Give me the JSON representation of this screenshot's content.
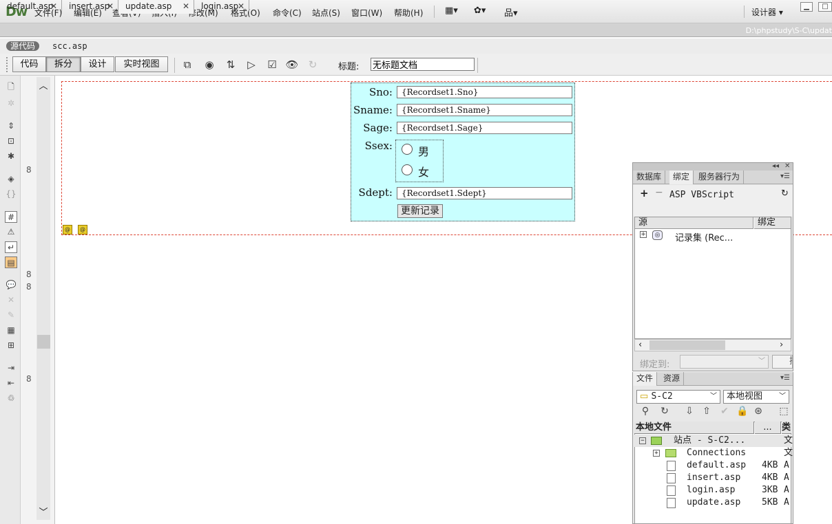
{
  "app": {
    "logo": "Dw"
  },
  "menu": [
    "文件(F)",
    "编辑(E)",
    "查看(V)",
    "插入(I)",
    "修改(M)",
    "格式(O)",
    "命令(C)",
    "站点(S)",
    "窗口(W)",
    "帮助(H)"
  ],
  "workspace": {
    "label": "设计器"
  },
  "tabs": [
    {
      "label": "default.asp"
    },
    {
      "label": "insert.asp"
    },
    {
      "label": "update.asp",
      "active": true
    },
    {
      "label": "login.asp"
    }
  ],
  "doc_path": "D:\\phpstudy\\S-C\\updat",
  "related": {
    "source_badge": "源代码",
    "file": "scc.asp"
  },
  "view_buttons": [
    "代码",
    "拆分",
    "设计",
    "实时视图"
  ],
  "active_view": "拆分",
  "doc_title": {
    "label": "标题:",
    "value": "无标题文档"
  },
  "line_numbers": [
    "8",
    "8",
    "8",
    "8"
  ],
  "form": {
    "fields": [
      {
        "label": "Sno:",
        "value": "{Recordset1.Sno}"
      },
      {
        "label": "Sname:",
        "value": "{Recordset1.Sname}"
      },
      {
        "label": "Sage:",
        "value": "{Recordset1.Sage}"
      }
    ],
    "ssex": {
      "label": "Ssex:",
      "options": [
        "男",
        "女"
      ]
    },
    "sdept": {
      "label": "Sdept:",
      "value": "{Recordset1.Sdept}"
    },
    "submit_label": "更新记录"
  },
  "bindings_panel": {
    "tabs": [
      "数据库",
      "绑定",
      "服务器行为"
    ],
    "active_tab": "绑定",
    "plus": "+",
    "minus": "−",
    "language": "ASP VBScript",
    "columns": [
      "源",
      "绑定"
    ],
    "tree_item": "记录集 (Rec...",
    "bind_to_label": "绑定到:",
    "insert_btn": "插"
  },
  "files_panel": {
    "tabs": [
      "文件",
      "资源"
    ],
    "active_tab": "文件",
    "site_select": "S-C2",
    "view_select": "本地视图",
    "columns": [
      "本地文件",
      "...",
      "类"
    ],
    "rows": [
      {
        "name": "站点 - S-C2...",
        "size": "",
        "type": "文",
        "level": 0,
        "kind": "site"
      },
      {
        "name": "Connections",
        "size": "",
        "type": "文",
        "level": 1,
        "kind": "folder"
      },
      {
        "name": "default.asp",
        "size": "4KB",
        "type": "A",
        "level": 2,
        "kind": "file"
      },
      {
        "name": "insert.asp",
        "size": "4KB",
        "type": "A",
        "level": 2,
        "kind": "file"
      },
      {
        "name": "login.asp",
        "size": "3KB",
        "type": "A",
        "level": 2,
        "kind": "file"
      },
      {
        "name": "update.asp",
        "size": "5KB",
        "type": "A",
        "level": 2,
        "kind": "file"
      }
    ]
  }
}
